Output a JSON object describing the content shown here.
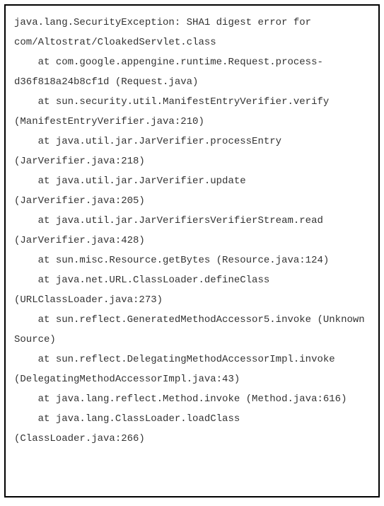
{
  "stacktrace": {
    "exception_header": "java.lang.SecurityException: SHA1 digest error for com/Altostrat/CloakedServlet.class",
    "frames": [
      "    at com.google.appengine.runtime.Request.process-d36f818a24b8cf1d (Request.java)",
      "    at sun.security.util.ManifestEntryVerifier.verify (ManifestEntryVerifier.java:210)",
      "    at java.util.jar.JarVerifier.processEntry (JarVerifier.java:218)",
      "    at java.util.jar.JarVerifier.update (JarVerifier.java:205)",
      "    at java.util.jar.JarVerifiersVerifierStream.read (JarVerifier.java:428)",
      "    at sun.misc.Resource.getBytes (Resource.java:124)",
      "    at java.net.URL.ClassLoader.defineClass (URLClassLoader.java:273)",
      "    at sun.reflect.GeneratedMethodAccessor5.invoke (Unknown Source)",
      "    at sun.reflect.DelegatingMethodAccessorImpl.invoke (DelegatingMethodAccessorImpl.java:43)",
      "    at java.lang.reflect.Method.invoke (Method.java:616)",
      "    at java.lang.ClassLoader.loadClass (ClassLoader.java:266)"
    ]
  }
}
